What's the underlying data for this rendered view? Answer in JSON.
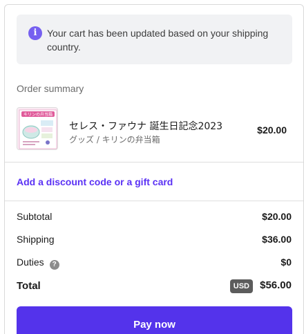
{
  "notice": {
    "icon": "info-icon",
    "icon_glyph": "i",
    "text": "Your cart has been updated based on your shipping country."
  },
  "summary": {
    "heading": "Order summary",
    "item": {
      "thumb_caption": "キリンの弁当箱",
      "name": "セレス・ファウナ 誕生日記念2023",
      "variant": "グッズ / キリンの弁当箱",
      "price": "$20.00"
    },
    "discount_link": "Add a discount code or a gift card",
    "subtotal": {
      "label": "Subtotal",
      "value": "$20.00"
    },
    "shipping": {
      "label": "Shipping",
      "value": "$36.00"
    },
    "duties": {
      "label": "Duties",
      "help_glyph": "?",
      "value": "$0"
    },
    "total": {
      "label": "Total",
      "currency": "USD",
      "value": "$56.00"
    }
  },
  "pay_button": "Pay now",
  "colors": {
    "accent": "#5433eb",
    "link": "#5a31f4",
    "info": "#7660f0"
  }
}
